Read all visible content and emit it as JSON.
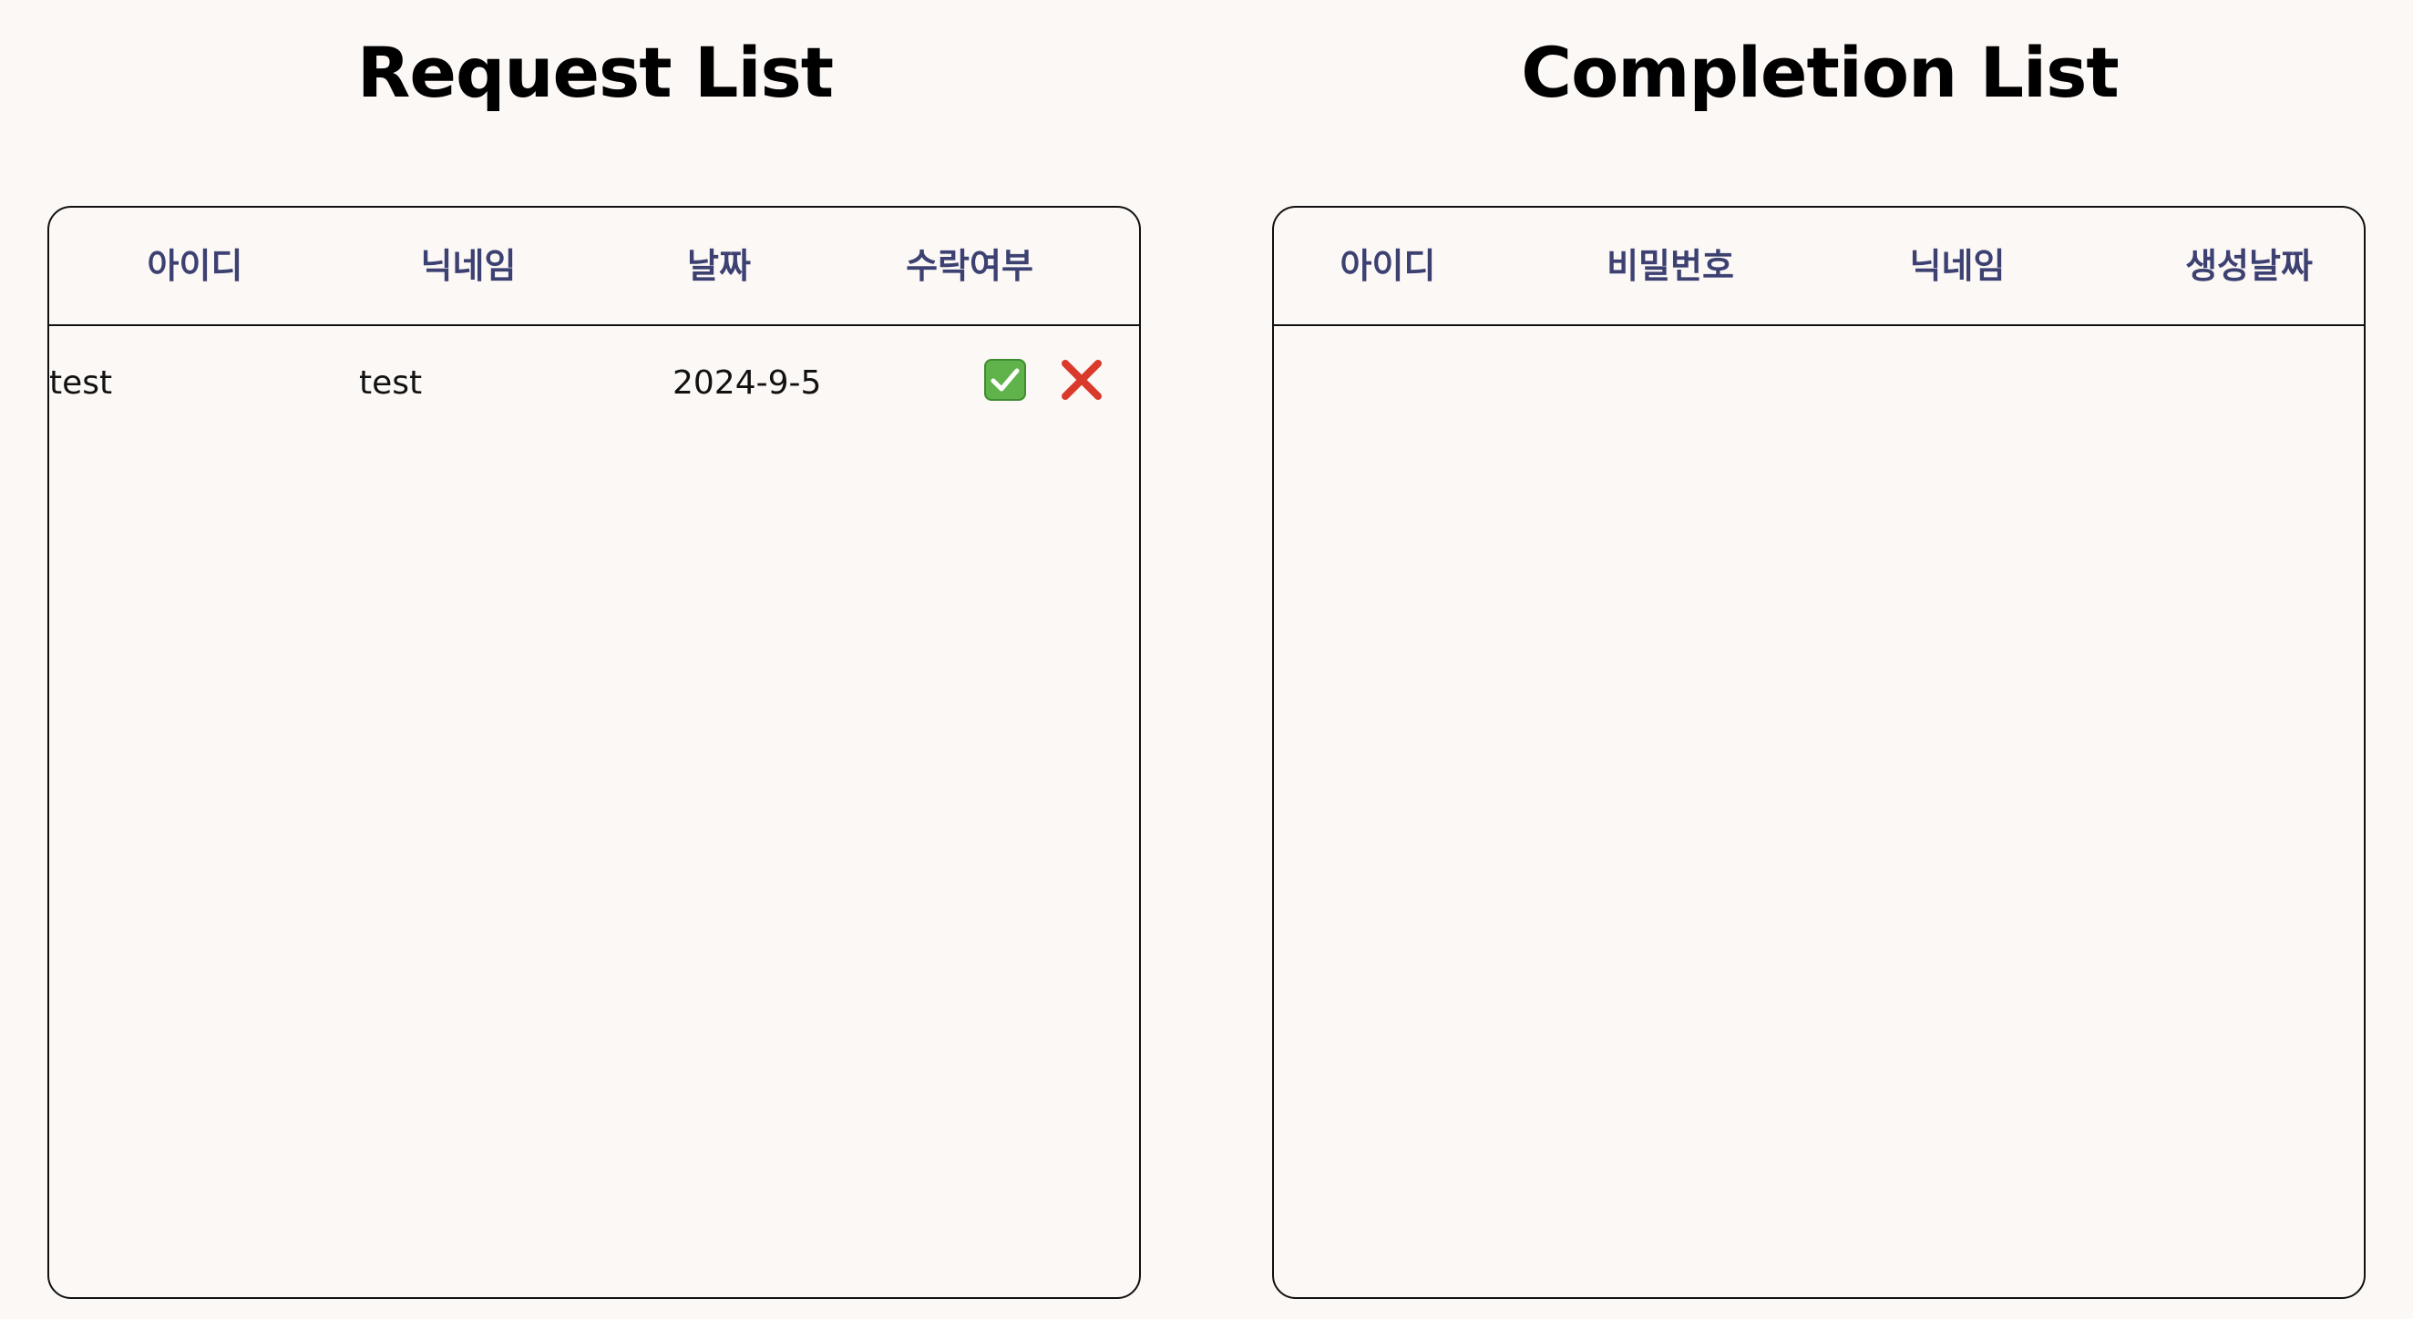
{
  "request_panel": {
    "title": "Request List",
    "headers": [
      "아이디",
      "닉네임",
      "날짜",
      "수락여부"
    ],
    "rows": [
      {
        "id": "test",
        "nickname": "test",
        "date": "2024-9-5",
        "accept_icon": "check-mark-button-icon",
        "reject_icon": "cross-mark-icon"
      }
    ]
  },
  "completion_panel": {
    "title": "Completion List",
    "headers": [
      "아이디",
      "비밀번호",
      "닉네임",
      "생성날짜"
    ],
    "rows": []
  },
  "colors": {
    "background": "#fcf8f6",
    "header_text": "#3d4172",
    "accept": "#5fb34a",
    "reject": "#d93a2b"
  }
}
